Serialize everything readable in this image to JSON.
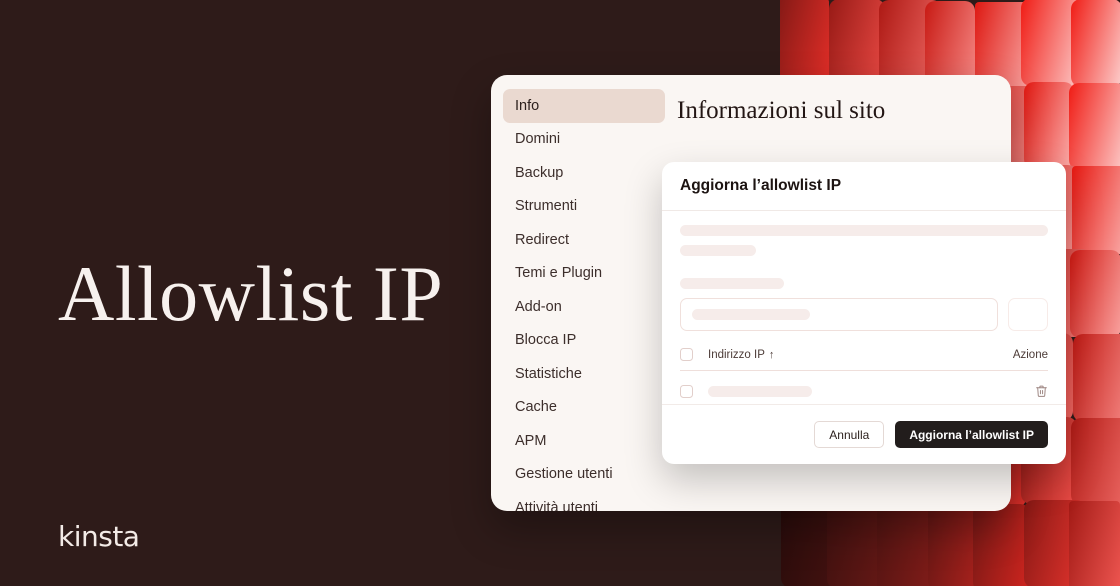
{
  "hero": {
    "title": "Allowlist IP",
    "logo": "kinsta"
  },
  "colors": {
    "background": "#2e1b19",
    "card": "#faf6f3",
    "accent_red": "#c41212",
    "active_nav": "#ead9d0",
    "button_primary": "#221d1c"
  },
  "app": {
    "content_title": "Informazioni sul sito",
    "sidebar": {
      "items": [
        {
          "label": "Info",
          "active": true
        },
        {
          "label": "Domini",
          "active": false
        },
        {
          "label": "Backup",
          "active": false
        },
        {
          "label": "Strumenti",
          "active": false
        },
        {
          "label": "Redirect",
          "active": false
        },
        {
          "label": "Temi e Plugin",
          "active": false
        },
        {
          "label": "Add-on",
          "active": false
        },
        {
          "label": "Blocca IP",
          "active": false
        },
        {
          "label": "Statistiche",
          "active": false
        },
        {
          "label": "Cache",
          "active": false
        },
        {
          "label": "APM",
          "active": false
        },
        {
          "label": "Gestione utenti",
          "active": false
        },
        {
          "label": "Attività utenti",
          "active": false
        }
      ]
    }
  },
  "modal": {
    "title": "Aggiorna l’allowlist IP",
    "input_placeholder": "",
    "input_value": "",
    "table": {
      "columns": [
        {
          "label": "Indirizzo IP",
          "sort": "↑"
        },
        {
          "label": "Azione"
        }
      ],
      "rows": [
        {
          "ip": "",
          "action_icon": "trash-icon"
        }
      ]
    },
    "footer": {
      "cancel_label": "Annulla",
      "submit_label": "Aggiorna l’allowlist IP"
    }
  }
}
